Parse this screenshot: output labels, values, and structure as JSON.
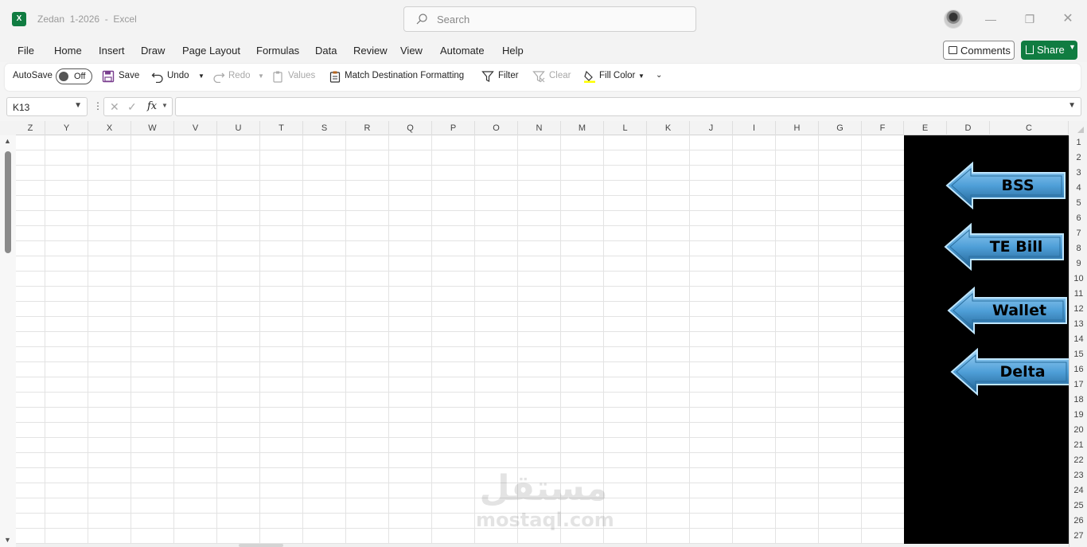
{
  "window": {
    "title": "Zedan  1-2026  -  Excel",
    "app_icon": "excel-icon",
    "search_placeholder": "Search",
    "controls": [
      "minimize-icon",
      "restore-icon",
      "close-icon"
    ]
  },
  "menu": {
    "tabs": [
      "File",
      "Home",
      "Insert",
      "Draw",
      "Page Layout",
      "Formulas",
      "Data",
      "Review",
      "View",
      "Automate",
      "Help"
    ],
    "comments_label": "Comments",
    "share_label": "Share"
  },
  "ribbon": {
    "autosave_label": "AutoSave",
    "autosave_state": "Off",
    "save_label": "Save",
    "undo_label": "Undo",
    "redo_label": "Redo",
    "values_label": "Values",
    "match_label": "Match Destination Formatting",
    "filter_label": "Filter",
    "clear_label": "Clear",
    "fill_color_label": "Fill Color",
    "fill_color_swatch": "#ffff00"
  },
  "formula_bar": {
    "name_box": "K13",
    "fx_label": "fx",
    "formula": ""
  },
  "grid": {
    "columns": [
      "Z",
      "Y",
      "X",
      "W",
      "V",
      "U",
      "T",
      "S",
      "R",
      "Q",
      "P",
      "O",
      "N",
      "M",
      "L",
      "K",
      "J",
      "I",
      "H",
      "G",
      "F",
      "E",
      "D",
      "C"
    ],
    "rows": [
      "1",
      "2",
      "3",
      "4",
      "5",
      "6",
      "7",
      "8",
      "9",
      "10",
      "11",
      "12",
      "13",
      "14",
      "15",
      "16",
      "17",
      "18",
      "19",
      "20",
      "21",
      "22",
      "23",
      "24",
      "25",
      "26",
      "27"
    ],
    "panel_color": "#000000"
  },
  "shapes": {
    "arrow_color": "#4f9fd8",
    "buttons": [
      "BSS",
      "TE Bill",
      "Wallet",
      "Delta"
    ]
  },
  "watermark": {
    "arabic": "مستقل",
    "latin": "mostaql.com"
  }
}
